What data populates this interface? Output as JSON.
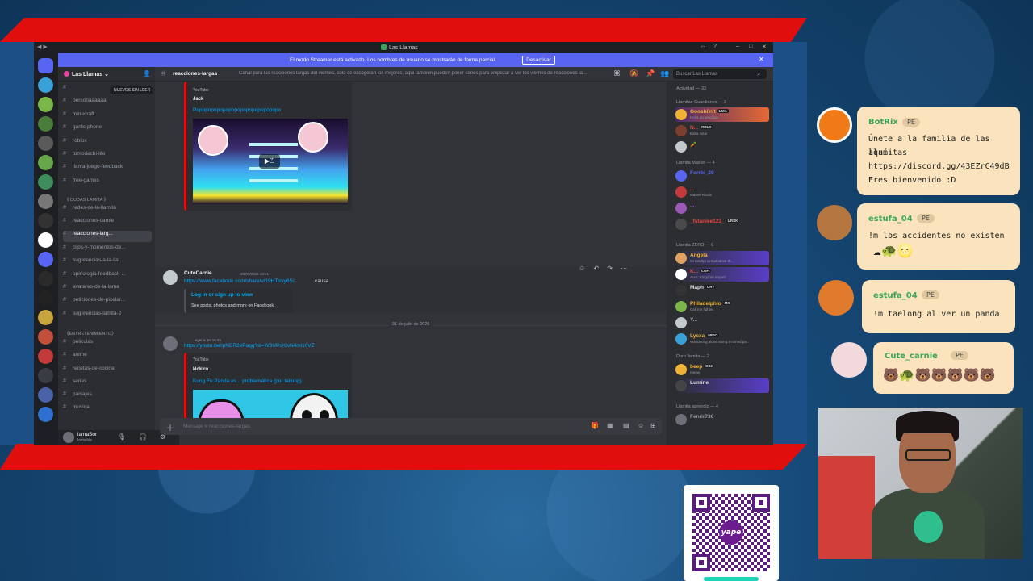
{
  "window": {
    "title": "Las Llamas",
    "streamer_banner": "El modo Streamer está activado. Los nombres de usuario se mostrarán de forma parcial.",
    "streamer_button": "Desactivar"
  },
  "guild": {
    "name": "Las Llamas",
    "unread_pill": "NUEVOS SIN LEER"
  },
  "channels": {
    "items": [
      {
        "label": "personaaaaaa"
      },
      {
        "label": "minecraft"
      },
      {
        "label": "gartic-phone"
      },
      {
        "label": "roblox"
      },
      {
        "label": "tomodachi-life"
      },
      {
        "label": "llama-juego-feedback"
      },
      {
        "label": "free-games"
      }
    ],
    "category_dudas": "《 DUDAS LAMITA 》",
    "items2": [
      {
        "label": "redes-de-la-llamita"
      },
      {
        "label": "reacciones-carnie"
      },
      {
        "label": "reacciones-larg..."
      },
      {
        "label": "clips-y-momentos-de..."
      },
      {
        "label": "sugerencias-a-la-lla..."
      },
      {
        "label": "opinologia-feedback-..."
      },
      {
        "label": "avatares-de-la-lama"
      },
      {
        "label": "peticiones-de-pixelar..."
      },
      {
        "label": "sugerencias-lamita-2"
      }
    ],
    "category_ent": "《ENTRETENIMIENTO》",
    "items3": [
      {
        "label": "peliculas"
      },
      {
        "label": "anime"
      },
      {
        "label": "recetas-de-cocina"
      },
      {
        "label": "series"
      },
      {
        "label": "paisajes"
      },
      {
        "label": "musica"
      }
    ]
  },
  "user_panel": {
    "name": "lamaSor",
    "status": "Invisible"
  },
  "chat_header": {
    "channel": "reacciones-largas",
    "topic": "Canal para las reacciones largas del viernes, solo se escogeran los mejores, aqui tambien pueden poner series para empezar a ver los viernes de reacciones la...",
    "search_placeholder": "Buscar Las Llamas"
  },
  "messages": {
    "embed1": {
      "provider": "YouTube",
      "author": "Jack",
      "title": "Popopopopopopopopopopopopopopo"
    },
    "msg2": {
      "author": "CuteCarnie",
      "time": "29/07/2026 13:41",
      "link": "https://www.facebook.com/share/v/19HTrrvy6S/",
      "text": "causa",
      "fb_title": "Log in or sign up to view",
      "fb_desc": "See posts, photos and more on Facebook."
    },
    "date_divider": "31 de julio de 2026",
    "msg3": {
      "time": "ayer a las 16:45",
      "link": "https://youtu.be/ipNER2ePaqg?si=W3UPoKlvN4mi10VZ",
      "provider": "YouTube",
      "author": "Nokiru",
      "title": "Kung Fu Panda es... problemática (por tailung)"
    }
  },
  "composer": {
    "placeholder": "Mensaje # reacciones-largas"
  },
  "members": {
    "activity": "Actividad — 33",
    "groups": [
      {
        "label": "Llamitas Guardianes — 3"
      },
      {
        "label": "Llamita Master — 4"
      },
      {
        "label": "Llamita ZERO — 6"
      },
      {
        "label": "Doro llamita — 2"
      },
      {
        "label": "Llamita aprendiz — 4"
      }
    ],
    "list": [
      {
        "name": "Gooshi'n't",
        "tag": "UMA",
        "sub": "Hoirs de gracioso",
        "color": "#f0b232"
      },
      {
        "name": "N...",
        "tag": "RBLX",
        "sub": "Baka mitai",
        "color": "#e64545"
      },
      {
        "name": "Forrbi_20",
        "tag": "",
        "sub": "",
        "color": "#5865f2"
      },
      {
        "name": "...",
        "tag": "",
        "sub": "Marvel Rivals",
        "color": "#e64545"
      },
      {
        "name": "...",
        "tag": "",
        "sub": "",
        "color": "#9b59b6"
      },
      {
        "name": "_fstanlee123_",
        "tag": "URSK",
        "sub": "",
        "color": "#e64545"
      },
      {
        "name": "Angela",
        "tag": "",
        "sub": "Im totally normal about th...",
        "color": "#f0b232"
      },
      {
        "name": "K...",
        "tag": "LOFI",
        "sub": "Aura: Kingdom Impact",
        "color": "#e64545"
      },
      {
        "name": "Maph",
        "tag": "URY",
        "sub": "",
        "color": "#dbdee1"
      },
      {
        "name": "Philadelphio",
        "tag": "MII",
        "sub": "Call me fighter.",
        "color": "#f0b232"
      },
      {
        "name": "Y...",
        "tag": "",
        "sub": "",
        "color": "#949ba4"
      },
      {
        "name": "Lycxa",
        "tag": "MIDO",
        "sub": "Wandering alone along a ruined pa...",
        "color": "#f0b232"
      },
      {
        "name": "beep",
        "tag": "CS2",
        "sub": "meow",
        "color": "#f0b232"
      },
      {
        "name": "Lumine",
        "tag": "",
        "sub": "",
        "color": "#dbdee1"
      },
      {
        "name": "Fenrir736",
        "tag": "",
        "sub": "",
        "color": "#949ba4"
      }
    ]
  },
  "overlay_chat": [
    {
      "name": "BotRix",
      "badge": "PE",
      "text_lines": [
        "Únete a la familia de las llamitas",
        "aquí:",
        "https://discord.gg/43EZrC49dB",
        "Eres bienvenido :D"
      ]
    },
    {
      "name": "estufa_04",
      "badge": "PE",
      "text_lines": [
        "!m los accidentes no existen"
      ]
    },
    {
      "name": "estufa_04",
      "badge": "PE",
      "text_lines": [
        "!m taelong al ver un panda"
      ]
    },
    {
      "name": "Cute_carnie",
      "badge": "PE",
      "text_lines": [
        ""
      ]
    }
  ],
  "qr": {
    "brand": "yape"
  },
  "colors": {
    "accent": "#5865f2",
    "red_band": "#e10e0e",
    "link": "#00a8fc"
  }
}
